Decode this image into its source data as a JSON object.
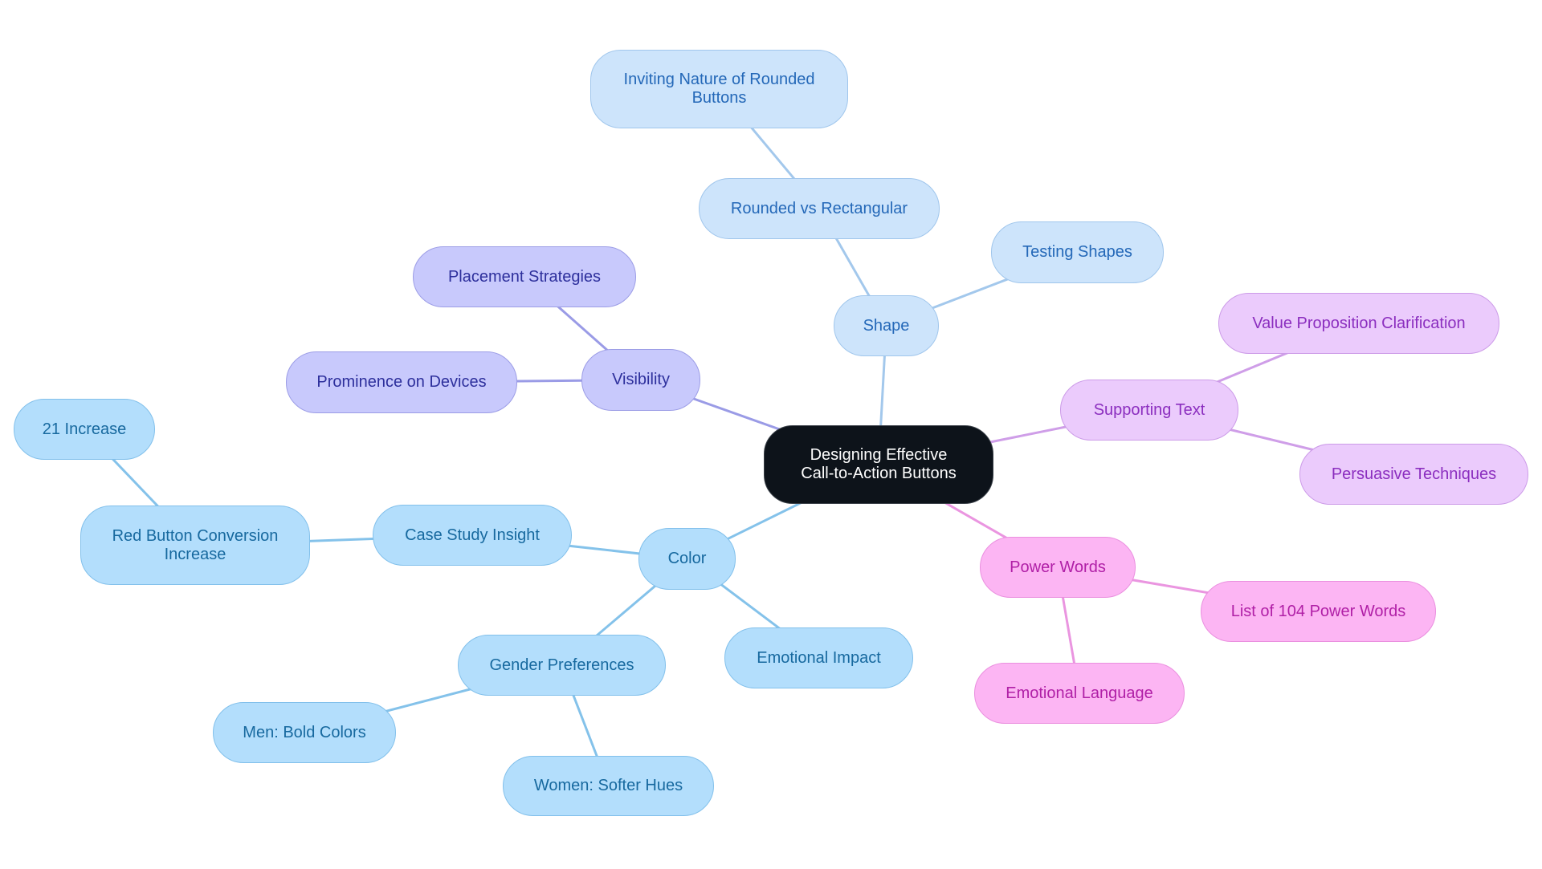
{
  "title": "Designing Effective Call-to-Action Buttons",
  "colors": {
    "shape_edge": "#a3c8ec",
    "visibility_edge": "#9a9be6",
    "color_edge": "#84c2ea",
    "supporting_edge": "#cf9ee8",
    "power_edge": "#ea95e0"
  },
  "nodes": {
    "root": "Designing Effective\nCall-to-Action Buttons",
    "shape": "Shape",
    "rounded_vs_rect": "Rounded vs Rectangular",
    "inviting_nature": "Inviting Nature of Rounded\nButtons",
    "testing_shapes": "Testing Shapes",
    "visibility": "Visibility",
    "placement": "Placement Strategies",
    "prominence": "Prominence on Devices",
    "color": "Color",
    "case_study": "Case Study Insight",
    "red_button": "Red Button Conversion\nIncrease",
    "increase_21": "21 Increase",
    "gender": "Gender Preferences",
    "men": "Men: Bold Colors",
    "women": "Women: Softer Hues",
    "emotional_impact": "Emotional Impact",
    "supporting_text": "Supporting Text",
    "value_prop": "Value Proposition Clarification",
    "persuasive": "Persuasive Techniques",
    "power_words": "Power Words",
    "list_104": "List of 104 Power Words",
    "emotional_language": "Emotional Language"
  },
  "edges": [
    [
      "root",
      "shape",
      "shape_edge"
    ],
    [
      "shape",
      "rounded_vs_rect",
      "shape_edge"
    ],
    [
      "rounded_vs_rect",
      "inviting_nature",
      "shape_edge"
    ],
    [
      "shape",
      "testing_shapes",
      "shape_edge"
    ],
    [
      "root",
      "visibility",
      "visibility_edge"
    ],
    [
      "visibility",
      "placement",
      "visibility_edge"
    ],
    [
      "visibility",
      "prominence",
      "visibility_edge"
    ],
    [
      "root",
      "color",
      "color_edge"
    ],
    [
      "color",
      "case_study",
      "color_edge"
    ],
    [
      "case_study",
      "red_button",
      "color_edge"
    ],
    [
      "red_button",
      "increase_21",
      "color_edge"
    ],
    [
      "color",
      "gender",
      "color_edge"
    ],
    [
      "gender",
      "men",
      "color_edge"
    ],
    [
      "gender",
      "women",
      "color_edge"
    ],
    [
      "color",
      "emotional_impact",
      "color_edge"
    ],
    [
      "root",
      "supporting_text",
      "supporting_edge"
    ],
    [
      "supporting_text",
      "value_prop",
      "supporting_edge"
    ],
    [
      "supporting_text",
      "persuasive",
      "supporting_edge"
    ],
    [
      "root",
      "power_words",
      "power_edge"
    ],
    [
      "power_words",
      "list_104",
      "power_edge"
    ],
    [
      "power_words",
      "emotional_language",
      "power_edge"
    ]
  ]
}
